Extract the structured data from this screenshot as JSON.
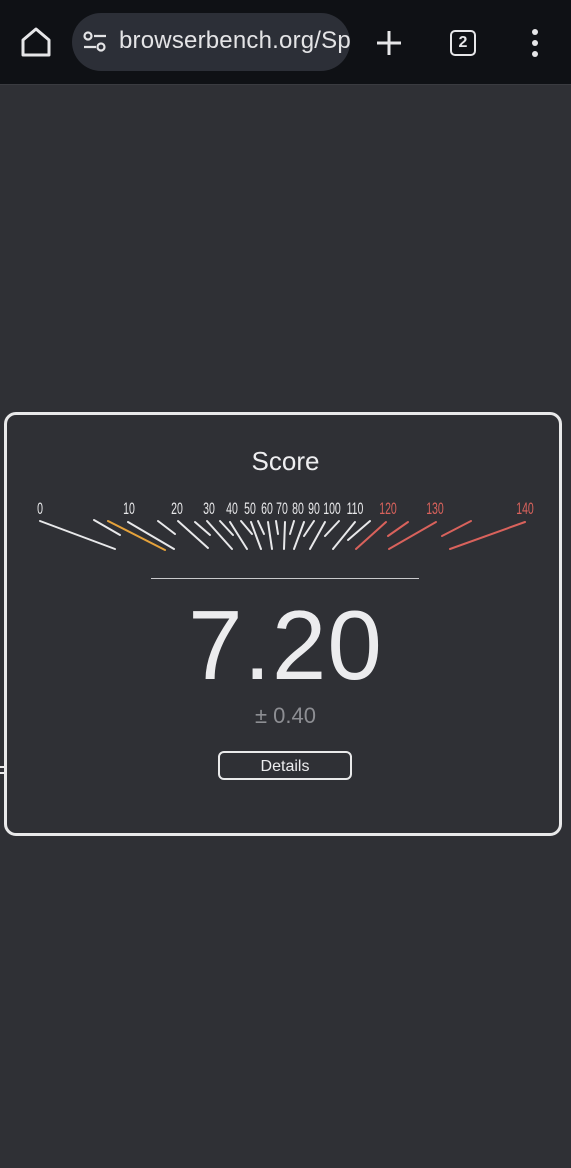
{
  "browser": {
    "url": "browserbench.org/Sp",
    "tab_count": "2",
    "icons": {
      "home": "home-icon",
      "site": "tune-icon",
      "new_tab": "plus-icon",
      "tabs": "tab-switcher-icon",
      "menu": "more-vert-icon"
    }
  },
  "score_panel": {
    "title": "Score",
    "value": "7.20",
    "error": "± 0.40",
    "details_label": "Details"
  },
  "gauge": {
    "labels": [
      "0",
      "10",
      "20",
      "30",
      "40",
      "50",
      "60",
      "70",
      "80",
      "90",
      "100",
      "110",
      "120",
      "130",
      "140"
    ],
    "current_value": 7.2,
    "colors": {
      "normal": "#e8e8ea",
      "highlight": "#e5a23b",
      "high": "#d9625c"
    }
  }
}
